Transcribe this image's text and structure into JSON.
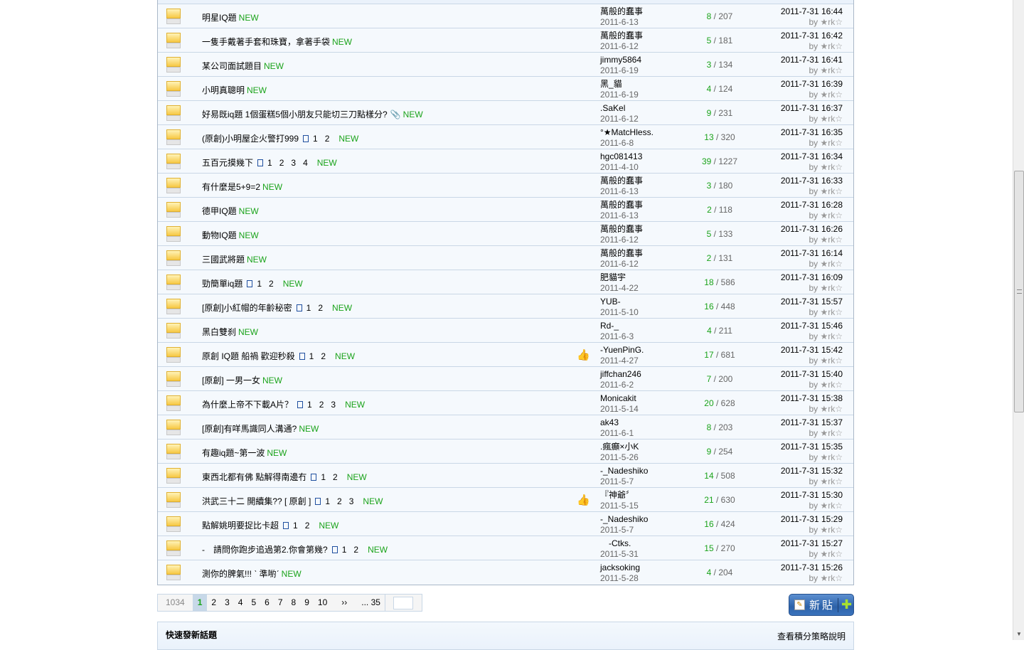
{
  "threads": [
    {
      "title": "明星IQ題",
      "pages": [],
      "attach": false,
      "thumb": false,
      "author": "萬般的蠢事",
      "date": "2011-6-13",
      "replies": "8",
      "views": "207",
      "last_time": "2011-7-31 16:44",
      "last_by": "★rk☆"
    },
    {
      "title": "一隻手戴著手套和珠寶，拿著手袋",
      "pages": [],
      "attach": false,
      "thumb": false,
      "author": "萬般的蠢事",
      "date": "2011-6-12",
      "replies": "5",
      "views": "181",
      "last_time": "2011-7-31 16:42",
      "last_by": "★rk☆"
    },
    {
      "title": "某公司面試題目",
      "pages": [],
      "attach": false,
      "thumb": false,
      "author": "jimmy5864",
      "date": "2011-6-19",
      "replies": "3",
      "views": "134",
      "last_time": "2011-7-31 16:41",
      "last_by": "★rk☆"
    },
    {
      "title": "小明真聰明",
      "pages": [],
      "attach": false,
      "thumb": false,
      "author": "黑_貓",
      "date": "2011-6-19",
      "replies": "4",
      "views": "124",
      "last_time": "2011-7-31 16:39",
      "last_by": "★rk☆"
    },
    {
      "title": "好易既iq題 1個蛋糕5個小朋友只能切三刀點樣分?",
      "pages": [],
      "attach": true,
      "thumb": false,
      "author": ".SaKel",
      "date": "2011-6-12",
      "replies": "9",
      "views": "231",
      "last_time": "2011-7-31 16:37",
      "last_by": "★rk☆"
    },
    {
      "title": "(原創)小明屋企火警打999",
      "pages": [
        "1",
        "2"
      ],
      "attach": false,
      "thumb": false,
      "author": "°★MatcHless.",
      "date": "2011-6-8",
      "replies": "13",
      "views": "320",
      "last_time": "2011-7-31 16:35",
      "last_by": "★rk☆"
    },
    {
      "title": "五百元摸幾下",
      "pages": [
        "1",
        "2",
        "3",
        "4"
      ],
      "attach": false,
      "thumb": false,
      "author": "hgc081413",
      "date": "2011-4-10",
      "replies": "39",
      "views": "1227",
      "last_time": "2011-7-31 16:34",
      "last_by": "★rk☆"
    },
    {
      "title": "有什麼是5+9=2",
      "pages": [],
      "attach": false,
      "thumb": false,
      "author": "萬般的蠢事",
      "date": "2011-6-13",
      "replies": "3",
      "views": "180",
      "last_time": "2011-7-31 16:33",
      "last_by": "★rk☆"
    },
    {
      "title": "德甲IQ題",
      "pages": [],
      "attach": false,
      "thumb": false,
      "author": "萬般的蠢事",
      "date": "2011-6-13",
      "replies": "2",
      "views": "118",
      "last_time": "2011-7-31 16:28",
      "last_by": "★rk☆"
    },
    {
      "title": "動物IQ題",
      "pages": [],
      "attach": false,
      "thumb": false,
      "author": "萬般的蠢事",
      "date": "2011-6-12",
      "replies": "5",
      "views": "133",
      "last_time": "2011-7-31 16:26",
      "last_by": "★rk☆"
    },
    {
      "title": "三國武將題",
      "pages": [],
      "attach": false,
      "thumb": false,
      "author": "萬般的蠢事",
      "date": "2011-6-12",
      "replies": "2",
      "views": "131",
      "last_time": "2011-7-31 16:14",
      "last_by": "★rk☆"
    },
    {
      "title": "勁簡單iq題",
      "pages": [
        "1",
        "2"
      ],
      "attach": false,
      "thumb": false,
      "author": "肥貓宇",
      "date": "2011-4-22",
      "replies": "18",
      "views": "586",
      "last_time": "2011-7-31 16:09",
      "last_by": "★rk☆"
    },
    {
      "title": "[原創]小紅帽的年齡秘密",
      "pages": [
        "1",
        "2"
      ],
      "attach": false,
      "thumb": false,
      "author": "YUB-",
      "date": "2011-5-10",
      "replies": "16",
      "views": "448",
      "last_time": "2011-7-31 15:57",
      "last_by": "★rk☆"
    },
    {
      "title": "黑白雙刹",
      "pages": [],
      "attach": false,
      "thumb": false,
      "author": "Rd-_",
      "date": "2011-6-3",
      "replies": "4",
      "views": "211",
      "last_time": "2011-7-31 15:46",
      "last_by": "★rk☆"
    },
    {
      "title": "原創 IQ題 船禍 歡迎秒殺",
      "pages": [
        "1",
        "2"
      ],
      "attach": false,
      "thumb": true,
      "author": "-YuenPinG.",
      "date": "2011-4-27",
      "replies": "17",
      "views": "681",
      "last_time": "2011-7-31 15:42",
      "last_by": "★rk☆"
    },
    {
      "title": "[原創] 一男一女",
      "pages": [],
      "attach": false,
      "thumb": false,
      "author": "jiffchan246",
      "date": "2011-6-2",
      "replies": "7",
      "views": "200",
      "last_time": "2011-7-31 15:40",
      "last_by": "★rk☆"
    },
    {
      "title": "為什麼上帝不下載A片？",
      "pages": [
        "1",
        "2",
        "3"
      ],
      "attach": false,
      "thumb": false,
      "author": "Monicakit",
      "date": "2011-5-14",
      "replies": "20",
      "views": "628",
      "last_time": "2011-7-31 15:38",
      "last_by": "★rk☆"
    },
    {
      "title": "[原創]有咩馬識同人溝通?",
      "pages": [],
      "attach": false,
      "thumb": false,
      "author": "ak43",
      "date": "2011-6-1",
      "replies": "8",
      "views": "203",
      "last_time": "2011-7-31 15:37",
      "last_by": "★rk☆"
    },
    {
      "title": "有趣iq題~第一波",
      "pages": [],
      "attach": false,
      "thumb": false,
      "author": ".瘋癲×小K",
      "date": "2011-5-26",
      "replies": "9",
      "views": "254",
      "last_time": "2011-7-31 15:35",
      "last_by": "★rk☆"
    },
    {
      "title": "東西北都有佛 點解得南邊冇",
      "pages": [
        "1",
        "2"
      ],
      "attach": false,
      "thumb": false,
      "author": "-_Nadeshiko",
      "date": "2011-5-7",
      "replies": "14",
      "views": "508",
      "last_time": "2011-7-31 15:32",
      "last_by": "★rk☆"
    },
    {
      "title": "洪武三十二 開續集?? [ 原創 ]",
      "pages": [
        "1",
        "2",
        "3"
      ],
      "attach": false,
      "thumb": true,
      "author": "『神爺〞",
      "date": "2011-5-15",
      "replies": "21",
      "views": "630",
      "last_time": "2011-7-31 15:30",
      "last_by": "★rk☆"
    },
    {
      "title": "點解姚明要捉比卡超",
      "pages": [
        "1",
        "2"
      ],
      "attach": false,
      "thumb": false,
      "author": "-_Nadeshiko",
      "date": "2011-5-7",
      "replies": "16",
      "views": "424",
      "last_time": "2011-7-31 15:29",
      "last_by": "★rk☆"
    },
    {
      "title": "-　請問你跑步追過第2.你會第幾?",
      "pages": [
        "1",
        "2"
      ],
      "attach": false,
      "thumb": false,
      "author": "　-Ctks.",
      "date": "2011-5-31",
      "replies": "15",
      "views": "270",
      "last_time": "2011-7-31 15:27",
      "last_by": "★rk☆"
    },
    {
      "title": "測你的脾氣!!! ˋ 準喲ˊ",
      "pages": [],
      "attach": false,
      "thumb": false,
      "author": "jacksoking",
      "date": "2011-5-28",
      "replies": "4",
      "views": "204",
      "last_time": "2011-7-31 15:26",
      "last_by": "★rk☆"
    }
  ],
  "labels": {
    "new": "NEW",
    "by": "by",
    "sep": " / "
  },
  "pager": {
    "total": "1034",
    "current": "1",
    "pages": [
      "2",
      "3",
      "4",
      "5",
      "6",
      "7",
      "8",
      "9",
      "10"
    ],
    "next": "››",
    "last": "... 35"
  },
  "new_post": {
    "label": "新貼"
  },
  "quick": {
    "title": "快速發新話題",
    "link": "查看積分策略說明"
  }
}
